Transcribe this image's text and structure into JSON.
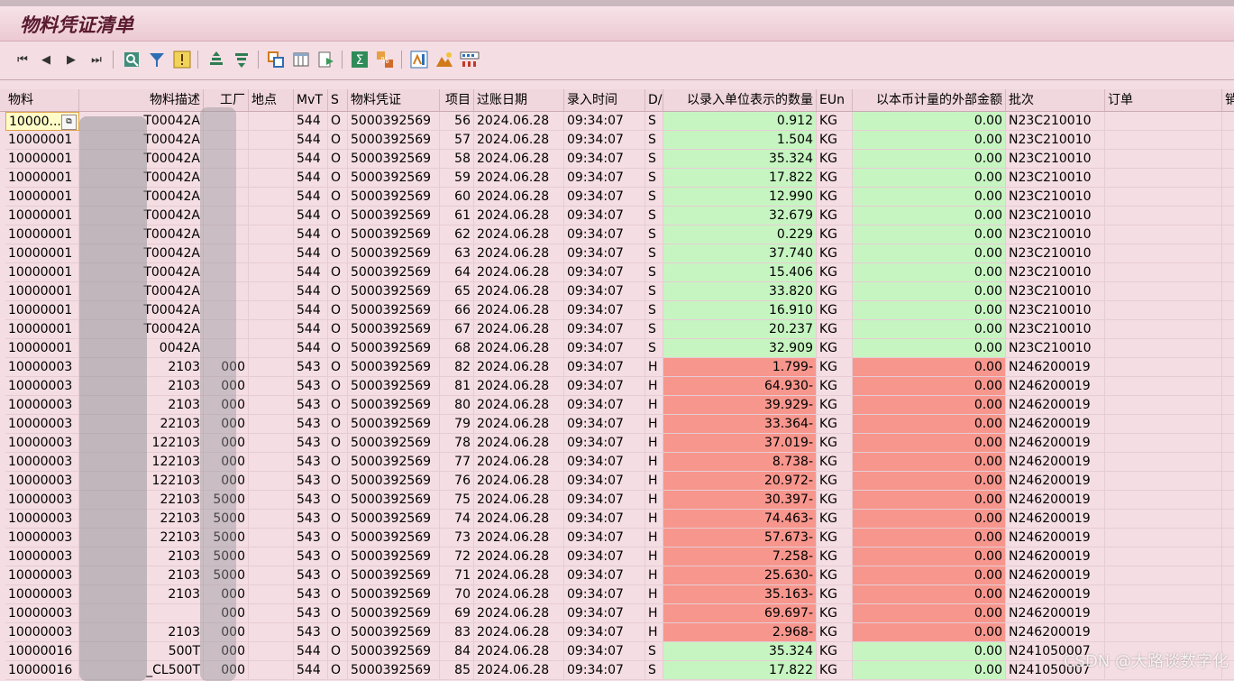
{
  "window": {
    "title": "物料凭证清单"
  },
  "toolbar": {
    "icons": [
      "first-page-icon",
      "previous-page-icon",
      "next-page-icon",
      "last-page-icon",
      "details-icon",
      "filter-icon",
      "exception-icon",
      "sort-ascending-icon",
      "sort-descending-icon",
      "copy-icon",
      "layout-columns-icon",
      "export-icon",
      "sum-icon",
      "subtotal-icon",
      "abc-analysis-icon",
      "graphic-icon",
      "find-icon"
    ]
  },
  "columns": [
    "物料",
    "物料描述",
    "工厂",
    "地点",
    "MvT",
    "S",
    "物料凭证",
    "项目",
    "过账日期",
    "录入时间",
    "D/",
    "以录入单位表示的数量",
    "EUn",
    "以本币计量的外部金额",
    "批次",
    "订单",
    "销"
  ],
  "rows": [
    {
      "mat": "10000...",
      "desc": "T00042A",
      "plant": "",
      "mvt": "544",
      "s": "O",
      "doc": "5000392569",
      "item": "56",
      "date": "2024.06.28",
      "time": "09:34:07",
      "dc": "S",
      "qty": "0.912",
      "eun": "KG",
      "amt": "0.00",
      "batch": "N23C210010"
    },
    {
      "mat": "10000001",
      "desc": "T00042A",
      "plant": "",
      "mvt": "544",
      "s": "O",
      "doc": "5000392569",
      "item": "57",
      "date": "2024.06.28",
      "time": "09:34:07",
      "dc": "S",
      "qty": "1.504",
      "eun": "KG",
      "amt": "0.00",
      "batch": "N23C210010"
    },
    {
      "mat": "10000001",
      "desc": "T00042A",
      "plant": "",
      "mvt": "544",
      "s": "O",
      "doc": "5000392569",
      "item": "58",
      "date": "2024.06.28",
      "time": "09:34:07",
      "dc": "S",
      "qty": "35.324",
      "eun": "KG",
      "amt": "0.00",
      "batch": "N23C210010"
    },
    {
      "mat": "10000001",
      "desc": "T00042A",
      "plant": "",
      "mvt": "544",
      "s": "O",
      "doc": "5000392569",
      "item": "59",
      "date": "2024.06.28",
      "time": "09:34:07",
      "dc": "S",
      "qty": "17.822",
      "eun": "KG",
      "amt": "0.00",
      "batch": "N23C210010"
    },
    {
      "mat": "10000001",
      "desc": "T00042A",
      "plant": "",
      "mvt": "544",
      "s": "O",
      "doc": "5000392569",
      "item": "60",
      "date": "2024.06.28",
      "time": "09:34:07",
      "dc": "S",
      "qty": "12.990",
      "eun": "KG",
      "amt": "0.00",
      "batch": "N23C210010"
    },
    {
      "mat": "10000001",
      "desc": "T00042A",
      "plant": "",
      "mvt": "544",
      "s": "O",
      "doc": "5000392569",
      "item": "61",
      "date": "2024.06.28",
      "time": "09:34:07",
      "dc": "S",
      "qty": "32.679",
      "eun": "KG",
      "amt": "0.00",
      "batch": "N23C210010"
    },
    {
      "mat": "10000001",
      "desc": "T00042A",
      "plant": "",
      "mvt": "544",
      "s": "O",
      "doc": "5000392569",
      "item": "62",
      "date": "2024.06.28",
      "time": "09:34:07",
      "dc": "S",
      "qty": "0.229",
      "eun": "KG",
      "amt": "0.00",
      "batch": "N23C210010"
    },
    {
      "mat": "10000001",
      "desc": "T00042A",
      "plant": "",
      "mvt": "544",
      "s": "O",
      "doc": "5000392569",
      "item": "63",
      "date": "2024.06.28",
      "time": "09:34:07",
      "dc": "S",
      "qty": "37.740",
      "eun": "KG",
      "amt": "0.00",
      "batch": "N23C210010"
    },
    {
      "mat": "10000001",
      "desc": "T00042A",
      "plant": "",
      "mvt": "544",
      "s": "O",
      "doc": "5000392569",
      "item": "64",
      "date": "2024.06.28",
      "time": "09:34:07",
      "dc": "S",
      "qty": "15.406",
      "eun": "KG",
      "amt": "0.00",
      "batch": "N23C210010"
    },
    {
      "mat": "10000001",
      "desc": "T00042A",
      "plant": "",
      "mvt": "544",
      "s": "O",
      "doc": "5000392569",
      "item": "65",
      "date": "2024.06.28",
      "time": "09:34:07",
      "dc": "S",
      "qty": "33.820",
      "eun": "KG",
      "amt": "0.00",
      "batch": "N23C210010"
    },
    {
      "mat": "10000001",
      "desc": "T00042A",
      "plant": "",
      "mvt": "544",
      "s": "O",
      "doc": "5000392569",
      "item": "66",
      "date": "2024.06.28",
      "time": "09:34:07",
      "dc": "S",
      "qty": "16.910",
      "eun": "KG",
      "amt": "0.00",
      "batch": "N23C210010"
    },
    {
      "mat": "10000001",
      "desc": "T00042A",
      "plant": "",
      "mvt": "544",
      "s": "O",
      "doc": "5000392569",
      "item": "67",
      "date": "2024.06.28",
      "time": "09:34:07",
      "dc": "S",
      "qty": "20.237",
      "eun": "KG",
      "amt": "0.00",
      "batch": "N23C210010"
    },
    {
      "mat": "10000001",
      "desc": "0042A",
      "plant": "",
      "mvt": "544",
      "s": "O",
      "doc": "5000392569",
      "item": "68",
      "date": "2024.06.28",
      "time": "09:34:07",
      "dc": "S",
      "qty": "32.909",
      "eun": "KG",
      "amt": "0.00",
      "batch": "N23C210010"
    },
    {
      "mat": "10000003",
      "desc": "2103",
      "plant": "000",
      "mvt": "543",
      "s": "O",
      "doc": "5000392569",
      "item": "82",
      "date": "2024.06.28",
      "time": "09:34:07",
      "dc": "H",
      "qty": "1.799-",
      "eun": "KG",
      "amt": "0.00",
      "batch": "N246200019"
    },
    {
      "mat": "10000003",
      "desc": "2103",
      "plant": "000",
      "mvt": "543",
      "s": "O",
      "doc": "5000392569",
      "item": "81",
      "date": "2024.06.28",
      "time": "09:34:07",
      "dc": "H",
      "qty": "64.930-",
      "eun": "KG",
      "amt": "0.00",
      "batch": "N246200019"
    },
    {
      "mat": "10000003",
      "desc": "2103",
      "plant": "000",
      "mvt": "543",
      "s": "O",
      "doc": "5000392569",
      "item": "80",
      "date": "2024.06.28",
      "time": "09:34:07",
      "dc": "H",
      "qty": "39.929-",
      "eun": "KG",
      "amt": "0.00",
      "batch": "N246200019"
    },
    {
      "mat": "10000003",
      "desc": "22103",
      "plant": "000",
      "mvt": "543",
      "s": "O",
      "doc": "5000392569",
      "item": "79",
      "date": "2024.06.28",
      "time": "09:34:07",
      "dc": "H",
      "qty": "33.364-",
      "eun": "KG",
      "amt": "0.00",
      "batch": "N246200019"
    },
    {
      "mat": "10000003",
      "desc": "122103",
      "plant": "000",
      "mvt": "543",
      "s": "O",
      "doc": "5000392569",
      "item": "78",
      "date": "2024.06.28",
      "time": "09:34:07",
      "dc": "H",
      "qty": "37.019-",
      "eun": "KG",
      "amt": "0.00",
      "batch": "N246200019"
    },
    {
      "mat": "10000003",
      "desc": "122103",
      "plant": "000",
      "mvt": "543",
      "s": "O",
      "doc": "5000392569",
      "item": "77",
      "date": "2024.06.28",
      "time": "09:34:07",
      "dc": "H",
      "qty": "8.738-",
      "eun": "KG",
      "amt": "0.00",
      "batch": "N246200019"
    },
    {
      "mat": "10000003",
      "desc": "122103",
      "plant": "000",
      "mvt": "543",
      "s": "O",
      "doc": "5000392569",
      "item": "76",
      "date": "2024.06.28",
      "time": "09:34:07",
      "dc": "H",
      "qty": "20.972-",
      "eun": "KG",
      "amt": "0.00",
      "batch": "N246200019"
    },
    {
      "mat": "10000003",
      "desc": "22103",
      "plant": "5000",
      "mvt": "543",
      "s": "O",
      "doc": "5000392569",
      "item": "75",
      "date": "2024.06.28",
      "time": "09:34:07",
      "dc": "H",
      "qty": "30.397-",
      "eun": "KG",
      "amt": "0.00",
      "batch": "N246200019"
    },
    {
      "mat": "10000003",
      "desc": "22103",
      "plant": "5000",
      "mvt": "543",
      "s": "O",
      "doc": "5000392569",
      "item": "74",
      "date": "2024.06.28",
      "time": "09:34:07",
      "dc": "H",
      "qty": "74.463-",
      "eun": "KG",
      "amt": "0.00",
      "batch": "N246200019"
    },
    {
      "mat": "10000003",
      "desc": "22103",
      "plant": "5000",
      "mvt": "543",
      "s": "O",
      "doc": "5000392569",
      "item": "73",
      "date": "2024.06.28",
      "time": "09:34:07",
      "dc": "H",
      "qty": "57.673-",
      "eun": "KG",
      "amt": "0.00",
      "batch": "N246200019"
    },
    {
      "mat": "10000003",
      "desc": "2103",
      "plant": "5000",
      "mvt": "543",
      "s": "O",
      "doc": "5000392569",
      "item": "72",
      "date": "2024.06.28",
      "time": "09:34:07",
      "dc": "H",
      "qty": "7.258-",
      "eun": "KG",
      "amt": "0.00",
      "batch": "N246200019"
    },
    {
      "mat": "10000003",
      "desc": "2103",
      "plant": "5000",
      "mvt": "543",
      "s": "O",
      "doc": "5000392569",
      "item": "71",
      "date": "2024.06.28",
      "time": "09:34:07",
      "dc": "H",
      "qty": "25.630-",
      "eun": "KG",
      "amt": "0.00",
      "batch": "N246200019"
    },
    {
      "mat": "10000003",
      "desc": "2103",
      "plant": "000",
      "mvt": "543",
      "s": "O",
      "doc": "5000392569",
      "item": "70",
      "date": "2024.06.28",
      "time": "09:34:07",
      "dc": "H",
      "qty": "35.163-",
      "eun": "KG",
      "amt": "0.00",
      "batch": "N246200019"
    },
    {
      "mat": "10000003",
      "desc": "",
      "plant": "000",
      "mvt": "543",
      "s": "O",
      "doc": "5000392569",
      "item": "69",
      "date": "2024.06.28",
      "time": "09:34:07",
      "dc": "H",
      "qty": "69.697-",
      "eun": "KG",
      "amt": "0.00",
      "batch": "N246200019"
    },
    {
      "mat": "10000003",
      "desc": "2103",
      "plant": "000",
      "mvt": "543",
      "s": "O",
      "doc": "5000392569",
      "item": "83",
      "date": "2024.06.28",
      "time": "09:34:07",
      "dc": "H",
      "qty": "2.968-",
      "eun": "KG",
      "amt": "0.00",
      "batch": "N246200019"
    },
    {
      "mat": "10000016",
      "desc": "500T",
      "plant": "000",
      "mvt": "544",
      "s": "O",
      "doc": "5000392569",
      "item": "84",
      "date": "2024.06.28",
      "time": "09:34:07",
      "dc": "S",
      "qty": "35.324",
      "eun": "KG",
      "amt": "0.00",
      "batch": "N241050007"
    },
    {
      "mat": "10000016",
      "desc": "_CL500T",
      "plant": "000",
      "mvt": "544",
      "s": "O",
      "doc": "5000392569",
      "item": "85",
      "date": "2024.06.28",
      "time": "09:34:07",
      "dc": "S",
      "qty": "17.822",
      "eun": "KG",
      "amt": "0.00",
      "batch": "N241050007"
    }
  ],
  "watermark": "CSDN @大路谈数字化",
  "colors": {
    "debit_green": "#c7f5c2",
    "credit_red": "#f7968d",
    "row_pink": "#f4dde3"
  }
}
